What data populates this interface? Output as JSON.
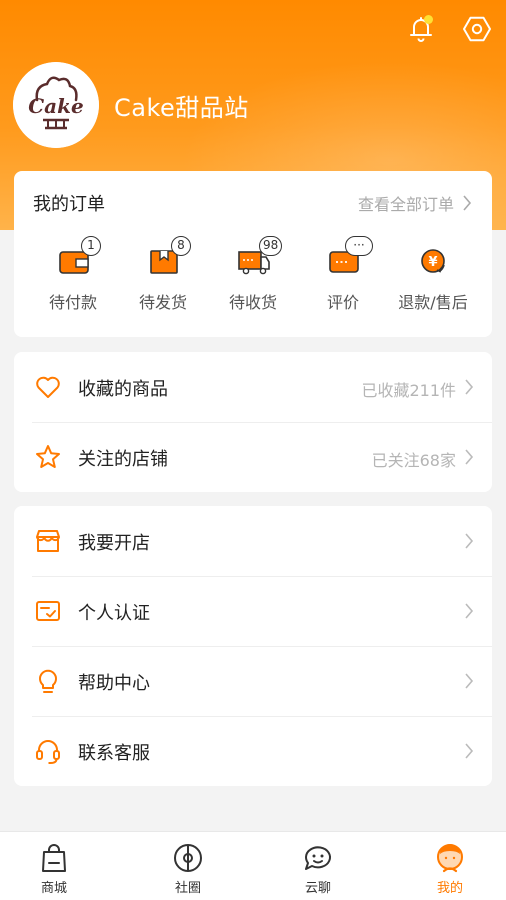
{
  "profile": {
    "name": "Cake甜品站",
    "avatar_logo_text": "Cake"
  },
  "orders": {
    "title": "我的订单",
    "view_all": "查看全部订单",
    "items": [
      {
        "label": "待付款",
        "badge": "1"
      },
      {
        "label": "待发货",
        "badge": "8"
      },
      {
        "label": "待收货",
        "badge": "98"
      },
      {
        "label": "评价",
        "badge": "···"
      },
      {
        "label": "退款/售后",
        "badge": ""
      }
    ]
  },
  "favorites": [
    {
      "label": "收藏的商品",
      "value": "已收藏211件"
    },
    {
      "label": "关注的店铺",
      "value": "已关注68家"
    }
  ],
  "tools": [
    {
      "label": "我要开店"
    },
    {
      "label": "个人认证"
    },
    {
      "label": "帮助中心"
    },
    {
      "label": "联系客服"
    }
  ],
  "tabs": [
    {
      "label": "商城"
    },
    {
      "label": "社圈"
    },
    {
      "label": "云聊"
    },
    {
      "label": "我的"
    }
  ],
  "colors": {
    "accent": "#ff7a00",
    "header_top": "#ff8a00",
    "header_bottom": "#ffb34a",
    "bell_dot": "#ffe033"
  }
}
